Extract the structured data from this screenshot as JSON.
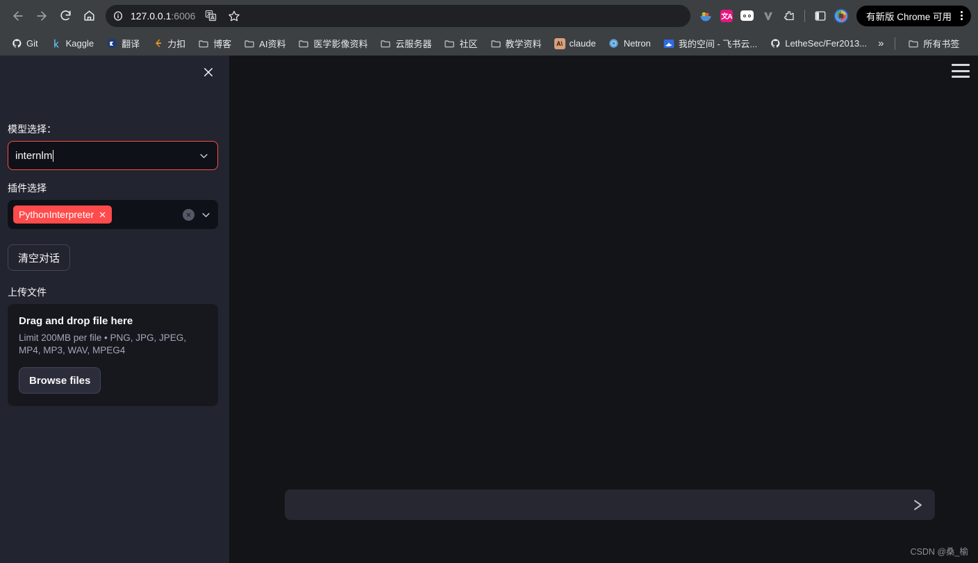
{
  "browser": {
    "nav": {
      "back_title": "Back",
      "forward_title": "Forward",
      "reload_title": "Reload",
      "home_title": "Home"
    },
    "omnibox": {
      "site_info_icon": "info-circle-icon",
      "host": "127.0.0.1",
      "port": ":6006",
      "translate_icon": "translate-icon",
      "bookmark_icon": "star-icon"
    },
    "extensions": [
      {
        "name": "fruit-bowl-extension-icon",
        "label": ""
      },
      {
        "name": "translate-extension-icon",
        "label": "文A"
      },
      {
        "name": "monica-extension-icon",
        "label": ""
      },
      {
        "name": "v-extension-icon",
        "label": "V"
      },
      {
        "name": "puzzle-extensions-icon",
        "label": ""
      }
    ],
    "side_panel_icon": "side-panel-icon",
    "profile_icon": "profile-avatar",
    "update_pill": {
      "label": "有新版 Chrome 可用",
      "menu_icon": "kebab-menu-icon"
    }
  },
  "bookmarks": {
    "items": [
      {
        "label": "Git",
        "icon": "github-icon"
      },
      {
        "label": "Kaggle",
        "icon": "kaggle-icon"
      },
      {
        "label": "翻译",
        "icon": "translate-bookmark-icon"
      },
      {
        "label": "力扣",
        "icon": "leetcode-icon"
      },
      {
        "label": "博客",
        "icon": "folder-icon"
      },
      {
        "label": "AI资料",
        "icon": "folder-icon"
      },
      {
        "label": "医学影像资料",
        "icon": "folder-icon"
      },
      {
        "label": "云服务器",
        "icon": "folder-icon"
      },
      {
        "label": "社区",
        "icon": "folder-icon"
      },
      {
        "label": "教学资料",
        "icon": "folder-icon"
      },
      {
        "label": "claude",
        "icon": "claude-icon"
      },
      {
        "label": "Netron",
        "icon": "netron-icon"
      },
      {
        "label": "我的空间 - 飞书云...",
        "icon": "feishu-icon"
      },
      {
        "label": "LetheSec/Fer2013...",
        "icon": "github-icon"
      }
    ],
    "overflow_label": "»",
    "all_bookmarks": {
      "label": "所有书签",
      "icon": "folder-icon"
    }
  },
  "sidebar": {
    "close_icon": "close-icon",
    "model_section": {
      "label": "模型选择：",
      "value": "internlm",
      "chevron_icon": "chevron-down-icon",
      "focus_color": "#ff4b4b"
    },
    "plugin_section": {
      "label": "插件选择",
      "tags": [
        {
          "label": "PythonInterpreter",
          "remove_icon": "tag-remove-icon",
          "color": "#ff4b4b"
        }
      ],
      "clear_icon": "clear-all-icon",
      "chevron_icon": "chevron-down-icon"
    },
    "clear_chat_button": "清空对话",
    "upload_section": {
      "label": "上传文件",
      "dropzone_title": "Drag and drop file here",
      "dropzone_hint": "Limit 200MB per file • PNG, JPG, JPEG, MP4, MP3, WAV, MPEG4",
      "browse_button": "Browse files"
    }
  },
  "main": {
    "menu_icon": "hamburger-menu-icon",
    "chat_input": {
      "value": "",
      "placeholder": "",
      "send_icon": "send-icon"
    },
    "watermark": "CSDN @桑_榆"
  }
}
